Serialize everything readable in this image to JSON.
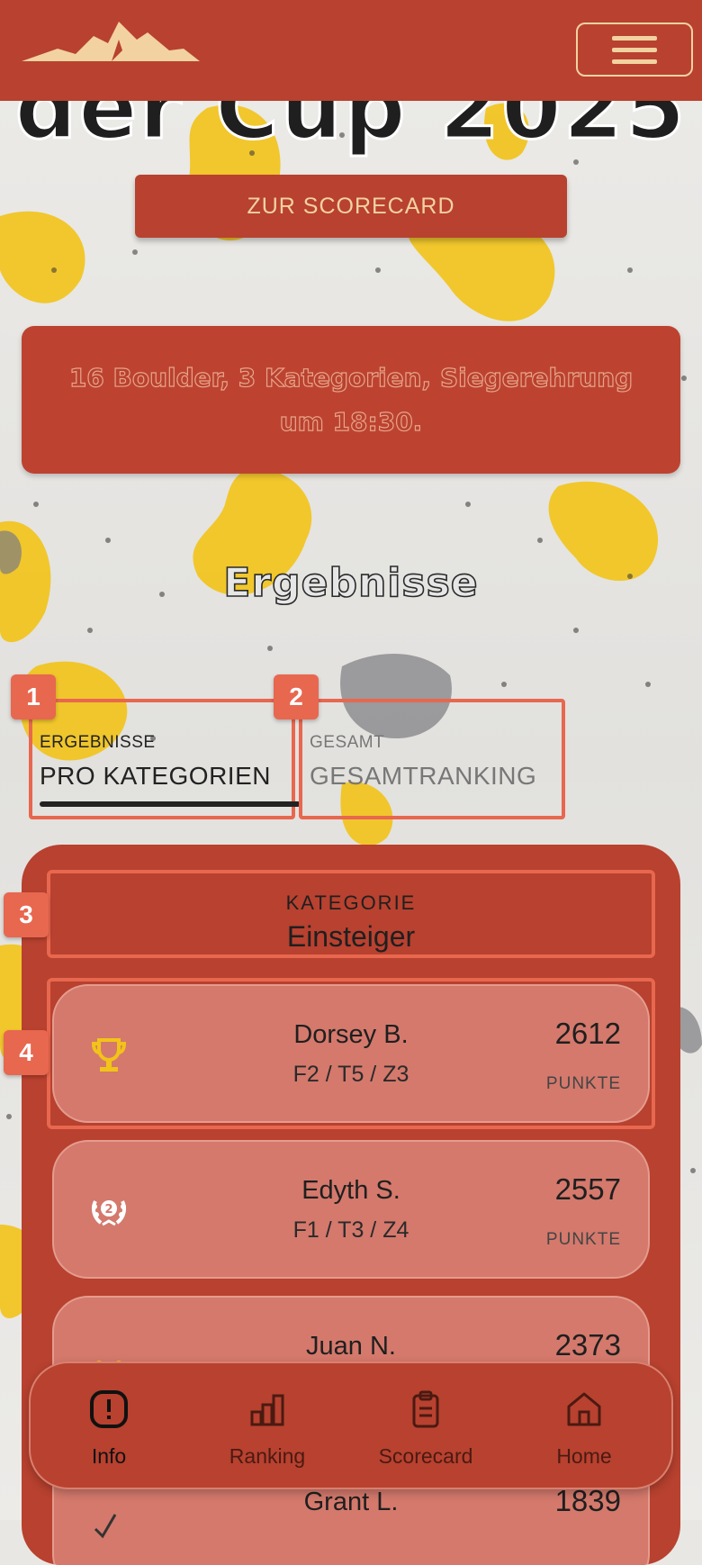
{
  "header": {
    "menu_label": "menu"
  },
  "hero": {
    "title": "der Cup 2025",
    "scorecard_button": "ZUR SCORECARD",
    "info_text": "16 Boulder, 3 Kategorien, Siegerehrung um 18:30."
  },
  "results": {
    "section_title": "Ergebnisse",
    "tabs": [
      {
        "small": "ERGEBNISSE",
        "label": "PRO KATEGORIEN",
        "active": true
      },
      {
        "small": "GESAMT",
        "label": "GESAMTRANKING",
        "active": false
      }
    ],
    "category": {
      "label": "KATEGORIE",
      "value": "Einsteiger"
    },
    "entries": [
      {
        "name": "Dorsey B.",
        "detail": "F2 / T5 / Z3",
        "points": "2612",
        "points_label": "PUNKTE",
        "icon": "trophy-icon"
      },
      {
        "name": "Edyth S.",
        "detail": "F1 / T3 / Z4",
        "points": "2557",
        "points_label": "PUNKTE",
        "icon": "laurel-2-icon"
      },
      {
        "name": "Juan N.",
        "detail": "",
        "points": "2373",
        "points_label": "PUNKTE",
        "icon": "medal-icon"
      },
      {
        "name": "Grant L.",
        "detail": "",
        "points": "1839",
        "points_label": "PUNKTE",
        "icon": "check-icon"
      }
    ]
  },
  "annotations": [
    "1",
    "2",
    "3",
    "4"
  ],
  "nav": {
    "items": [
      {
        "label": "Info",
        "icon": "info-icon",
        "active": true
      },
      {
        "label": "Ranking",
        "icon": "ranking-icon",
        "active": false
      },
      {
        "label": "Scorecard",
        "icon": "clipboard-icon",
        "active": false
      },
      {
        "label": "Home",
        "icon": "home-icon",
        "active": false
      }
    ]
  },
  "colors": {
    "brand": "#b8412f",
    "accent": "#f2d2a0",
    "highlight": "#e8674f",
    "trophy": "#f2c318"
  }
}
